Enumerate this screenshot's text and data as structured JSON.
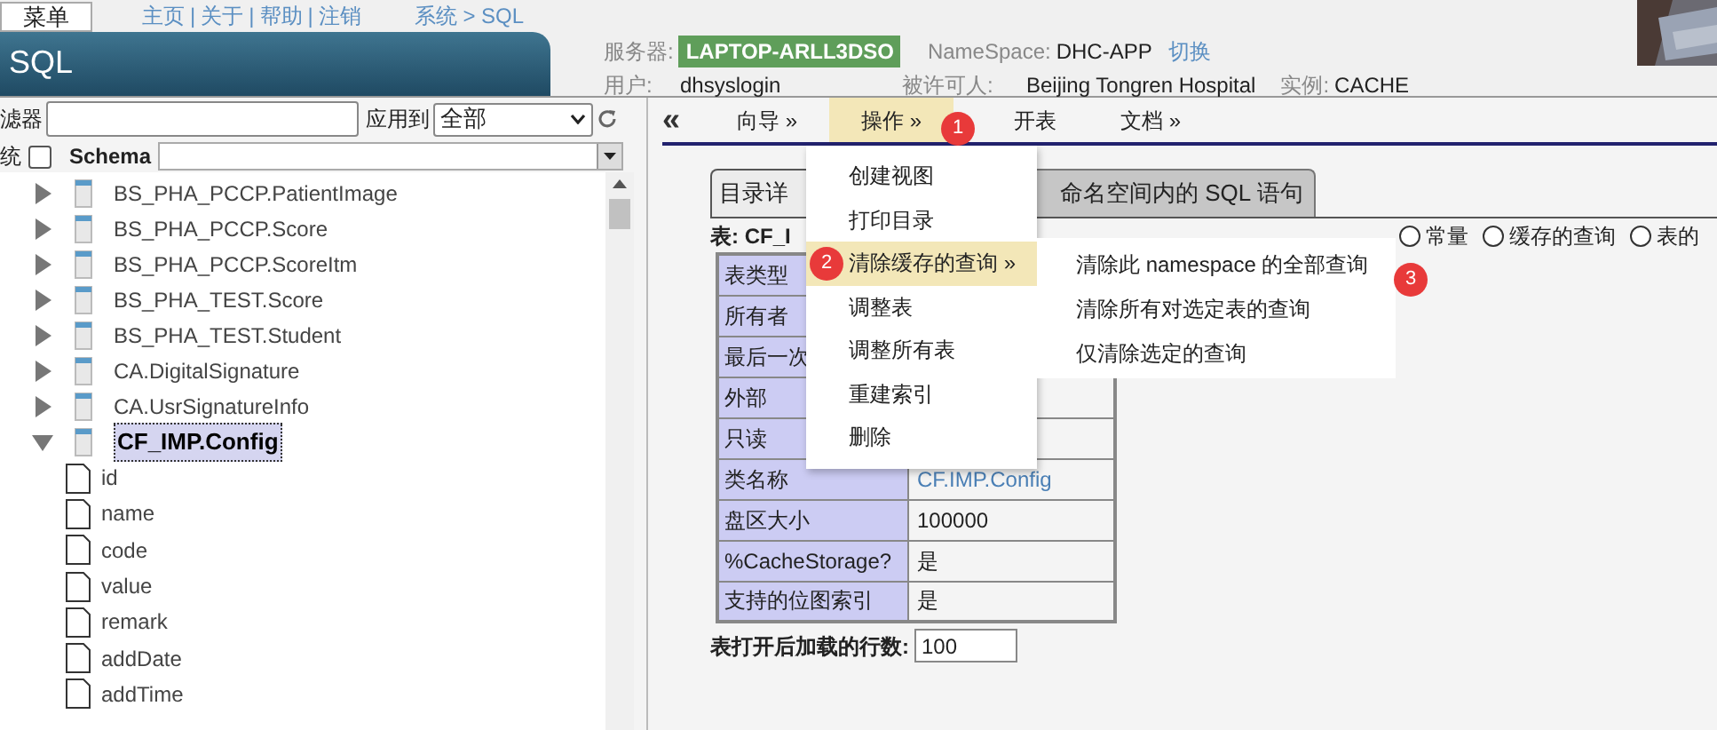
{
  "top_bar": {
    "menu_button": "菜单",
    "links": [
      "主页",
      "关于",
      "帮助",
      "注销"
    ],
    "separator": "|",
    "breadcrumb": "系统 > SQL"
  },
  "title": "SQL",
  "server_info": {
    "server_label": "服务器:",
    "server": "LAPTOP-ARLL3DSO",
    "namespace_label": "NameSpace:",
    "namespace": "DHC-APP",
    "switch_link": "切换",
    "user_label": "用户:",
    "user": "dhsyslogin",
    "licensee_label": "被许可人:",
    "licensee": "Beijing Tongren Hospital",
    "instance_label": "实例:",
    "instance": "CACHE"
  },
  "filter": {
    "label": "滤器",
    "apply_label": "应用到",
    "apply_value": "全部"
  },
  "schema_row": {
    "system_label": "统",
    "system_checked": false,
    "schema_label": "Schema"
  },
  "tree": [
    {
      "label": "BS_PHA_PCCP.PatientImage",
      "expanded": false,
      "selected": false
    },
    {
      "label": "BS_PHA_PCCP.Score",
      "expanded": false,
      "selected": false
    },
    {
      "label": "BS_PHA_PCCP.ScoreItm",
      "expanded": false,
      "selected": false
    },
    {
      "label": "BS_PHA_TEST.Score",
      "expanded": false,
      "selected": false
    },
    {
      "label": "BS_PHA_TEST.Student",
      "expanded": false,
      "selected": false
    },
    {
      "label": "CA.DigitalSignature",
      "expanded": false,
      "selected": false
    },
    {
      "label": "CA.UsrSignatureInfo",
      "expanded": false,
      "selected": false
    },
    {
      "label": "CF_IMP.Config",
      "expanded": true,
      "selected": true,
      "children": [
        {
          "label": "id"
        },
        {
          "label": "name"
        },
        {
          "label": "code"
        },
        {
          "label": "value"
        },
        {
          "label": "remark"
        },
        {
          "label": "addDate"
        },
        {
          "label": "addTime"
        }
      ]
    }
  ],
  "nav": {
    "collapse": "«",
    "items": [
      {
        "label": "向导 »",
        "selected": false
      },
      {
        "label": "操作 »",
        "selected": true
      },
      {
        "label": "开表",
        "selected": false
      },
      {
        "label": "文档 »",
        "selected": false
      }
    ]
  },
  "tabs": [
    {
      "label": "目录详",
      "selected": true
    },
    {
      "label": "命名空间内的 SQL 语句",
      "selected": false
    }
  ],
  "table_caption": "表: CF_I",
  "radios": [
    {
      "label": "常量",
      "selected": false
    },
    {
      "label": "缓存的查询",
      "selected": false
    },
    {
      "label": "表的",
      "selected": false
    }
  ],
  "properties": [
    {
      "label": "表类型"
    },
    {
      "label": "所有者"
    },
    {
      "label": "最后一次"
    },
    {
      "label": "外部"
    },
    {
      "label": "只读"
    },
    {
      "label": "类名称",
      "value": "CF.IMP.Config",
      "kind": "link"
    },
    {
      "label": "盘区大小",
      "value": "100000",
      "kind": "text"
    },
    {
      "label": "%CacheStorage?",
      "value": "是",
      "kind": "text"
    },
    {
      "label": "支持的位图索引",
      "value": "是",
      "kind": "text"
    }
  ],
  "rows_to_load": {
    "label": "表打开后加载的行数:",
    "value": "100"
  },
  "menu": {
    "items": [
      {
        "label": "创建视图",
        "selected": false
      },
      {
        "label": "打印目录",
        "selected": false
      },
      {
        "label": "清除缓存的查询 »",
        "selected": true
      },
      {
        "label": "调整表",
        "selected": false
      },
      {
        "label": "调整所有表",
        "selected": false
      },
      {
        "label": "重建索引",
        "selected": false
      },
      {
        "label": "删除",
        "selected": false
      }
    ]
  },
  "submenu": {
    "items": [
      {
        "label": "清除此 namespace 的全部查询"
      },
      {
        "label": "清除所有对选定表的查询"
      },
      {
        "label": "仅清除选定的查询"
      }
    ]
  },
  "badges": [
    "1",
    "2",
    "3"
  ]
}
